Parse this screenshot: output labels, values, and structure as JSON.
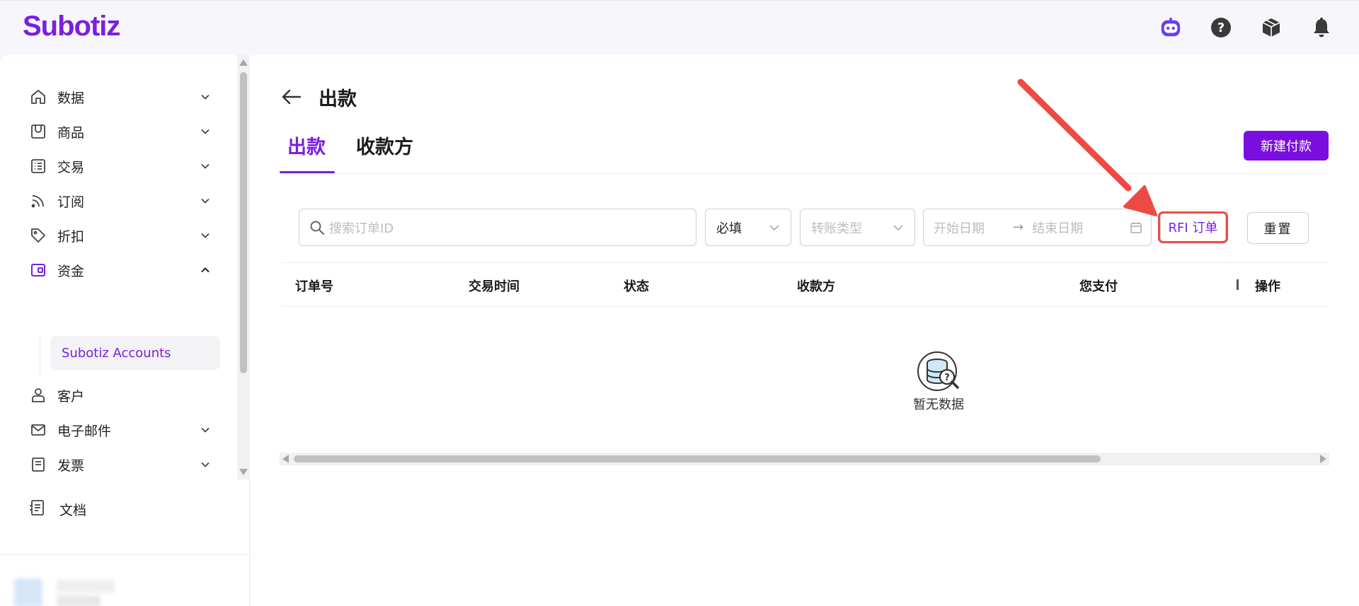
{
  "app": {
    "logo_text": "Subotiz",
    "brand_color": "#7a1fe0"
  },
  "topbar": {
    "icons": [
      "assistant-bot-icon",
      "help-icon",
      "package-icon",
      "notification-bell-icon"
    ]
  },
  "sidebar": {
    "items": [
      {
        "label": "数据",
        "icon": "home-icon",
        "chevron": "down"
      },
      {
        "label": "商品",
        "icon": "store-icon",
        "chevron": "down"
      },
      {
        "label": "交易",
        "icon": "list-icon",
        "chevron": "down"
      },
      {
        "label": "订阅",
        "icon": "rss-icon",
        "chevron": "down"
      },
      {
        "label": "折扣",
        "icon": "tag-icon",
        "chevron": "down"
      },
      {
        "label": "资金",
        "icon": "wallet-icon",
        "chevron": "up"
      },
      {
        "label": "客户",
        "icon": "user-icon",
        "chevron": "none"
      },
      {
        "label": "电子邮件",
        "icon": "mail-icon",
        "chevron": "down"
      },
      {
        "label": "发票",
        "icon": "invoice-icon",
        "chevron": "down"
      }
    ],
    "subitem": "Subotiz Accounts",
    "docs_label": "文档"
  },
  "page": {
    "title": "出款",
    "tabs": [
      "出款",
      "收款方"
    ],
    "active_tab": 0,
    "new_button": "新建付款"
  },
  "filters": {
    "search_placeholder": "搜索订单ID",
    "required_value": "必填",
    "transfer_type_placeholder": "转账类型",
    "start_date_placeholder": "开始日期",
    "date_arrow": "→",
    "end_date_placeholder": "结束日期",
    "rfi_button": "RFI 订单",
    "reset_button": "重置"
  },
  "table": {
    "columns": [
      "订单号",
      "交易时间",
      "状态",
      "收款方",
      "您支付",
      "操作"
    ],
    "rows": [],
    "empty_text": "暂无数据"
  },
  "annotation": {
    "arrow_color": "#ee4a45",
    "highlight_target": "rfi-orders-button"
  }
}
